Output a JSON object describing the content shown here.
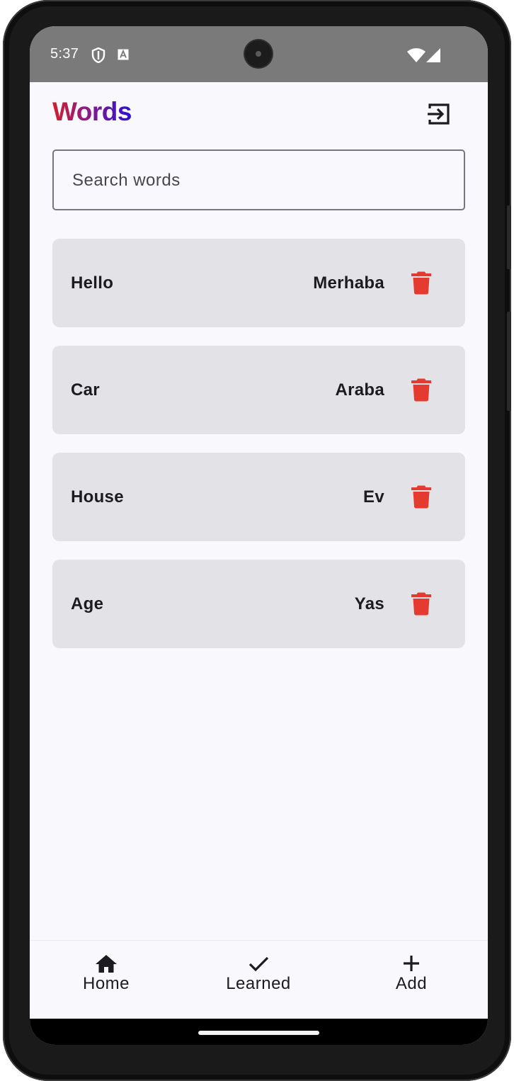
{
  "status_bar": {
    "time": "5:37",
    "icons": [
      "shield-icon",
      "a-notification-icon",
      "wifi-icon",
      "signal-icon"
    ]
  },
  "header": {
    "title": "Words",
    "title_gradient": [
      "#d0202c",
      "#8a1a8a",
      "#2a10d8"
    ],
    "logout_icon": "logout-icon"
  },
  "search": {
    "placeholder": "Search words",
    "value": ""
  },
  "words": [
    {
      "english": "Hello",
      "turkish": "Merhaba"
    },
    {
      "english": "Car",
      "turkish": "Araba"
    },
    {
      "english": "House",
      "turkish": "Ev"
    },
    {
      "english": "Age",
      "turkish": "Yas"
    }
  ],
  "colors": {
    "delete": "#e53a2f",
    "card_bg": "#e3e2e6",
    "screen_bg": "#f9f8fd",
    "text": "#1c1b1f"
  },
  "bottom_nav": {
    "items": [
      {
        "label": "Home",
        "icon": "home-icon"
      },
      {
        "label": "Learned",
        "icon": "check-icon"
      },
      {
        "label": "Add",
        "icon": "plus-icon"
      }
    ]
  }
}
